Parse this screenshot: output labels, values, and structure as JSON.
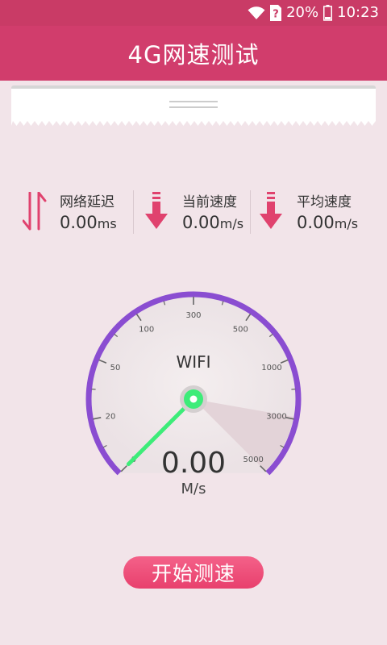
{
  "status_bar": {
    "battery": "20%",
    "time": "10:23",
    "icons": [
      "wifi-icon",
      "sim-icon",
      "battery-icon"
    ]
  },
  "app_bar": {
    "title": "4G网速测试"
  },
  "metrics": [
    {
      "icon": "latency-arrows-icon",
      "label": "网络延迟",
      "value": "0.00",
      "unit": "ms"
    },
    {
      "icon": "download-arrow-icon",
      "label": "当前速度",
      "value": "0.00",
      "unit": "m/s"
    },
    {
      "icon": "download-arrow-icon",
      "label": "平均速度",
      "value": "0.00",
      "unit": "m/s"
    }
  ],
  "gauge": {
    "network": "WIFI",
    "value": "0.00",
    "unit": "M/s",
    "scale_labels": [
      "0",
      "20",
      "50",
      "100",
      "300",
      "500",
      "1000",
      "3000",
      "5000"
    ],
    "needle_value": 0
  },
  "start_button": {
    "label": "开始测速"
  },
  "colors": {
    "primary": "#d13d6c",
    "background": "#f2e4e9",
    "gauge_ring": "#8a4dd1",
    "needle": "#3dec79",
    "button": "#ee4d78"
  }
}
